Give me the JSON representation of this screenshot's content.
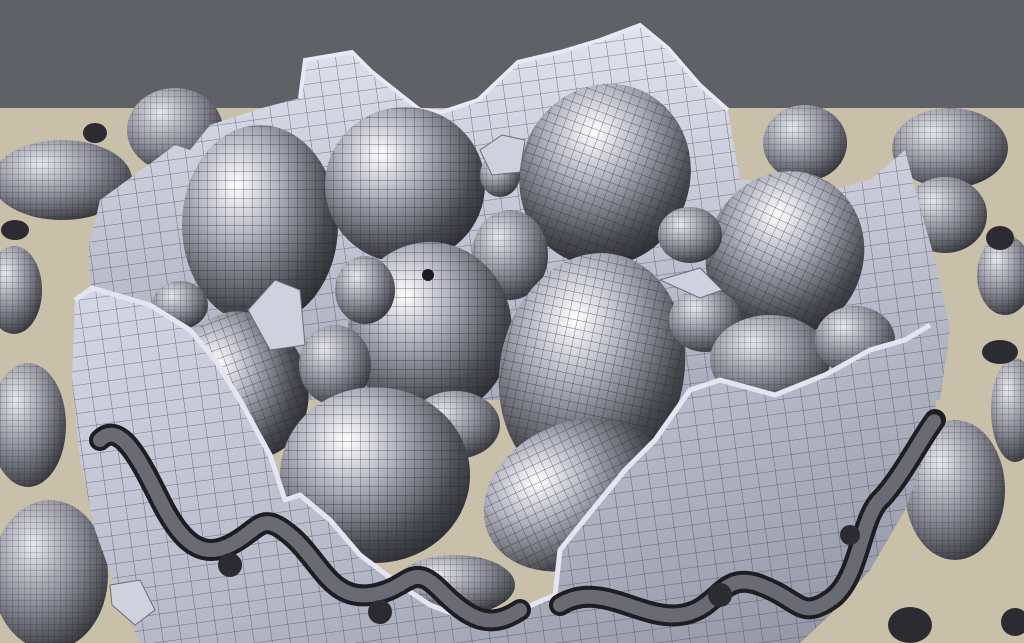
{
  "scene": {
    "background_color": "#5f6166",
    "floor_color": "#c9c0a9",
    "egg_highlight": "#ffffff",
    "egg_mid": "#b4b4c2",
    "egg_shadow": "#2f2f36",
    "shell_color": "#b9bccb",
    "shell_rim_color": "#d6d7e6",
    "wire_color": "#1d1d22",
    "rope_color": "#3a3a40"
  }
}
